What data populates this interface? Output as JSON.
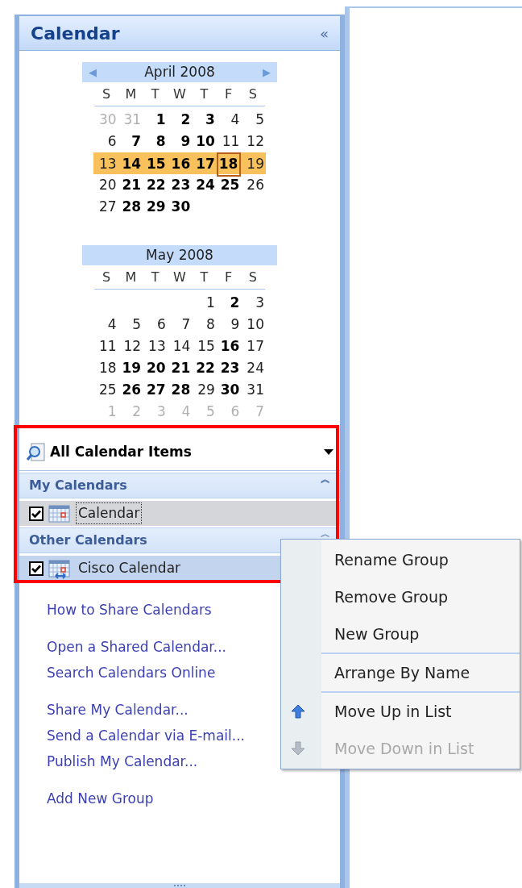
{
  "pane": {
    "title": "Calendar",
    "collapse_glyph": "«"
  },
  "months": [
    {
      "title": "April 2008",
      "nav": true,
      "prev_glyph": "◀",
      "next_glyph": "▶",
      "weekdays": [
        "S",
        "M",
        "T",
        "W",
        "T",
        "F",
        "S"
      ],
      "weeks": [
        {
          "highlighted": false,
          "days": [
            {
              "text": "30",
              "kind": "other"
            },
            {
              "text": "31",
              "kind": "other"
            },
            {
              "text": "1",
              "kind": "busy"
            },
            {
              "text": "2",
              "kind": "busy"
            },
            {
              "text": "3",
              "kind": "busy"
            },
            {
              "text": "4",
              "kind": "normal"
            },
            {
              "text": "5",
              "kind": "normal"
            }
          ]
        },
        {
          "highlighted": false,
          "days": [
            {
              "text": "6",
              "kind": "normal"
            },
            {
              "text": "7",
              "kind": "busy"
            },
            {
              "text": "8",
              "kind": "busy"
            },
            {
              "text": "9",
              "kind": "busy"
            },
            {
              "text": "10",
              "kind": "busy"
            },
            {
              "text": "11",
              "kind": "normal"
            },
            {
              "text": "12",
              "kind": "normal"
            }
          ]
        },
        {
          "highlighted": true,
          "days": [
            {
              "text": "13",
              "kind": "normal"
            },
            {
              "text": "14",
              "kind": "busy"
            },
            {
              "text": "15",
              "kind": "busy"
            },
            {
              "text": "16",
              "kind": "busy"
            },
            {
              "text": "17",
              "kind": "busy"
            },
            {
              "text": "18",
              "kind": "busy",
              "today": true
            },
            {
              "text": "19",
              "kind": "normal"
            }
          ]
        },
        {
          "highlighted": false,
          "days": [
            {
              "text": "20",
              "kind": "normal"
            },
            {
              "text": "21",
              "kind": "busy"
            },
            {
              "text": "22",
              "kind": "busy"
            },
            {
              "text": "23",
              "kind": "busy"
            },
            {
              "text": "24",
              "kind": "busy"
            },
            {
              "text": "25",
              "kind": "busy"
            },
            {
              "text": "26",
              "kind": "normal"
            }
          ]
        },
        {
          "highlighted": false,
          "days": [
            {
              "text": "27",
              "kind": "normal"
            },
            {
              "text": "28",
              "kind": "busy"
            },
            {
              "text": "29",
              "kind": "busy"
            },
            {
              "text": "30",
              "kind": "busy"
            },
            {
              "kind": "blank"
            },
            {
              "kind": "blank"
            },
            {
              "kind": "blank"
            }
          ]
        }
      ]
    },
    {
      "title": "May 2008",
      "weekdays": [
        "S",
        "M",
        "T",
        "W",
        "T",
        "F",
        "S"
      ],
      "weeks": [
        {
          "highlighted": false,
          "days": [
            {
              "kind": "blank"
            },
            {
              "kind": "blank"
            },
            {
              "kind": "blank"
            },
            {
              "kind": "blank"
            },
            {
              "text": "1",
              "kind": "normal"
            },
            {
              "text": "2",
              "kind": "busy"
            },
            {
              "text": "3",
              "kind": "normal"
            }
          ]
        },
        {
          "highlighted": false,
          "days": [
            {
              "text": "4",
              "kind": "normal"
            },
            {
              "text": "5",
              "kind": "normal"
            },
            {
              "text": "6",
              "kind": "normal"
            },
            {
              "text": "7",
              "kind": "normal"
            },
            {
              "text": "8",
              "kind": "normal"
            },
            {
              "text": "9",
              "kind": "normal"
            },
            {
              "text": "10",
              "kind": "normal"
            }
          ]
        },
        {
          "highlighted": false,
          "days": [
            {
              "text": "11",
              "kind": "normal"
            },
            {
              "text": "12",
              "kind": "normal"
            },
            {
              "text": "13",
              "kind": "normal"
            },
            {
              "text": "14",
              "kind": "normal"
            },
            {
              "text": "15",
              "kind": "normal"
            },
            {
              "text": "16",
              "kind": "busy"
            },
            {
              "text": "17",
              "kind": "normal"
            }
          ]
        },
        {
          "highlighted": false,
          "days": [
            {
              "text": "18",
              "kind": "normal"
            },
            {
              "text": "19",
              "kind": "busy"
            },
            {
              "text": "20",
              "kind": "busy"
            },
            {
              "text": "21",
              "kind": "busy"
            },
            {
              "text": "22",
              "kind": "busy"
            },
            {
              "text": "23",
              "kind": "busy"
            },
            {
              "text": "24",
              "kind": "normal"
            }
          ]
        },
        {
          "highlighted": false,
          "days": [
            {
              "text": "25",
              "kind": "normal"
            },
            {
              "text": "26",
              "kind": "busy"
            },
            {
              "text": "27",
              "kind": "busy"
            },
            {
              "text": "28",
              "kind": "busy"
            },
            {
              "text": "29",
              "kind": "normal"
            },
            {
              "text": "30",
              "kind": "busy"
            },
            {
              "text": "31",
              "kind": "normal"
            }
          ]
        },
        {
          "highlighted": false,
          "days": [
            {
              "text": "1",
              "kind": "other"
            },
            {
              "text": "2",
              "kind": "other"
            },
            {
              "text": "3",
              "kind": "other"
            },
            {
              "text": "4",
              "kind": "other"
            },
            {
              "text": "5",
              "kind": "other"
            },
            {
              "text": "6",
              "kind": "other"
            },
            {
              "text": "7",
              "kind": "other"
            }
          ]
        }
      ]
    }
  ],
  "view_dropdown": {
    "value": "All Calendar Items"
  },
  "groups": [
    {
      "title": "My Calendars",
      "chevron": "︽",
      "calendars": [
        {
          "name": "Calendar",
          "checked": true,
          "selected": true,
          "hot": false,
          "shared": false
        }
      ]
    },
    {
      "title": "Other Calendars",
      "chevron": "︿",
      "calendars": [
        {
          "name": "Cisco Calendar",
          "checked": true,
          "selected": false,
          "hot": true,
          "shared": true
        }
      ]
    }
  ],
  "links": [
    [
      "How to Share Calendars"
    ],
    [
      "Open a Shared Calendar...",
      "Search Calendars Online"
    ],
    [
      "Share My Calendar...",
      "Send a Calendar via E-mail...",
      "Publish My Calendar..."
    ],
    [
      "Add New Group"
    ]
  ],
  "context_menu": {
    "sections": [
      [
        {
          "label": "Rename Group",
          "disabled": false,
          "kind": "plain"
        },
        {
          "label": "Remove Group",
          "disabled": false,
          "kind": "plain"
        },
        {
          "label": "New Group",
          "disabled": false,
          "kind": "plain"
        }
      ],
      [
        {
          "label": "Arrange By Name",
          "disabled": false,
          "kind": "plain"
        }
      ],
      [
        {
          "label": "Move Up in List",
          "disabled": false,
          "kind": "move_up"
        },
        {
          "label": "Move Down in List",
          "disabled": true,
          "kind": "move_down"
        }
      ]
    ]
  }
}
